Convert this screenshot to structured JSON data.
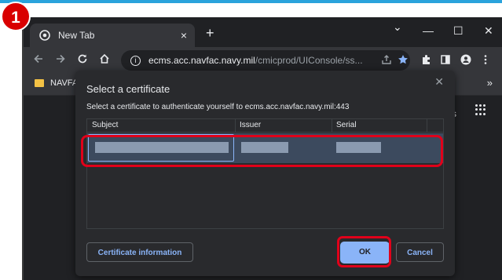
{
  "browser": {
    "tab_title": "New Tab",
    "tab_close": "×",
    "new_tab": "+",
    "window_controls": {
      "minimize": "—",
      "maximize": "☐",
      "close": "✕",
      "menu_chevron": "⌄"
    },
    "url_host": "ecms.acc.navfac.navy.mil",
    "url_path": "/cmicprod/UIConsole/ss...",
    "bookmark": "NAVFAC",
    "bookmarks_more": "»",
    "page_side_text": "s"
  },
  "dialog": {
    "title": "Select a certificate",
    "subtitle": "Select a certificate to authenticate yourself to ecms.acc.navfac.navy.mil:443",
    "close": "✕",
    "columns": {
      "subject": "Subject",
      "issuer": "Issuer",
      "serial": "Serial"
    },
    "rows": [
      {
        "subject": "",
        "issuer": "",
        "serial": "",
        "selected": true
      }
    ],
    "certificate_info_button": "Certificate information",
    "ok_button": "OK",
    "cancel_button": "Cancel"
  },
  "annotation": {
    "step_number": "1",
    "highlight_color": "#e0001a",
    "badge_color": "#d90000"
  },
  "colors": {
    "accent_blue": "#8ab4f8",
    "dark_bg": "#202124",
    "dialog_bg": "#292a2d",
    "selected_row": "#3c4a5e"
  }
}
